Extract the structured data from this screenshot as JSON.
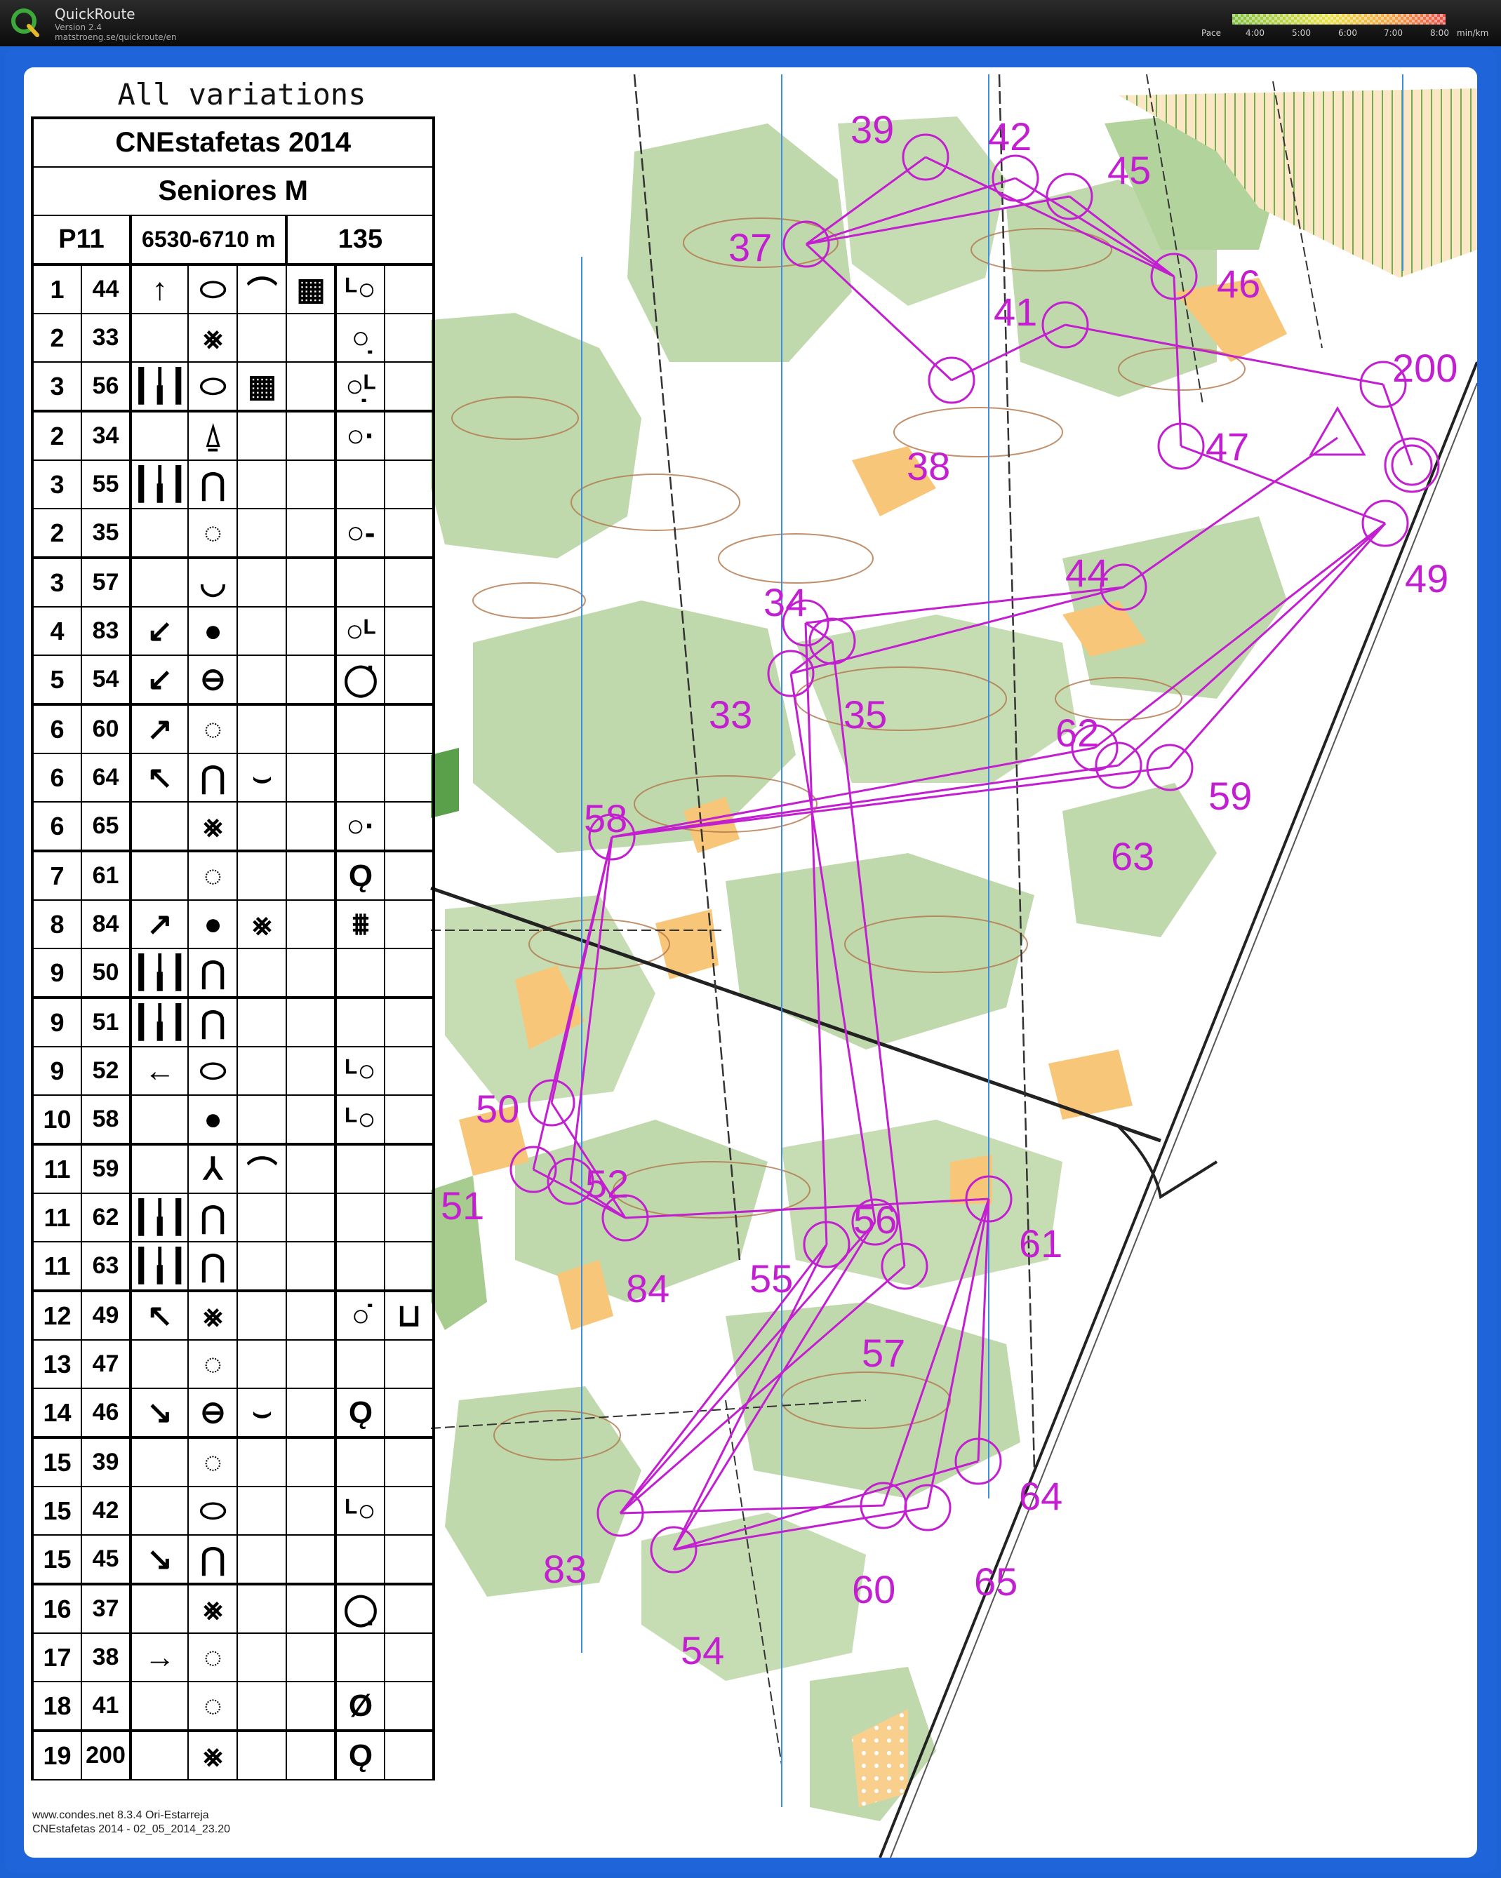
{
  "app": {
    "name": "QuickRoute",
    "version": "Version 2.4",
    "url": "matstroeng.se/quickroute/en",
    "pace_label": "Pace",
    "pace_ticks": [
      "4:00",
      "5:00",
      "6:00",
      "7:00",
      "8:00"
    ],
    "pace_unit": "min/km"
  },
  "header": {
    "variations": "All variations",
    "event": "CNEstafetas 2014",
    "category": "Seniores M",
    "course": "P11",
    "length": "6530-6710 m",
    "climb": "135"
  },
  "controls": [
    {
      "n": "1",
      "code": "44",
      "c": "↑",
      "d": "⬭",
      "e": "⌒",
      "f": "▦",
      "h": "ᴸ○"
    },
    {
      "n": "2",
      "code": "33",
      "c": "",
      "d": "⨳",
      "e": "",
      "f": "",
      "h": "○̣"
    },
    {
      "n": "3",
      "code": "56",
      "c": "┃╽┃",
      "d": "⬭",
      "e": "▦",
      "f": "",
      "h": "○̣ᴸ"
    },
    {
      "n": "2",
      "code": "34",
      "c": "",
      "d": "⍙",
      "e": "",
      "f": "",
      "h": "○·"
    },
    {
      "n": "3",
      "code": "55",
      "c": "┃╽┃",
      "d": "⋂",
      "e": "",
      "f": "",
      "h": ""
    },
    {
      "n": "2",
      "code": "35",
      "c": "",
      "d": "◌",
      "e": "",
      "f": "",
      "h": "○-"
    },
    {
      "n": "3",
      "code": "57",
      "c": "",
      "d": "◡",
      "e": "",
      "f": "",
      "h": ""
    },
    {
      "n": "4",
      "code": "83",
      "c": "↙",
      "d": "●",
      "e": "",
      "f": "",
      "h": "○ᴸ"
    },
    {
      "n": "5",
      "code": "54",
      "c": "↙",
      "d": "⊖",
      "e": "",
      "f": "",
      "h": "◯̇"
    },
    {
      "n": "6",
      "code": "60",
      "c": "↗",
      "d": "◌",
      "e": "",
      "f": "",
      "h": ""
    },
    {
      "n": "6",
      "code": "64",
      "c": "↖",
      "d": "⋂",
      "e": "⌣",
      "f": "",
      "h": ""
    },
    {
      "n": "6",
      "code": "65",
      "c": "",
      "d": "⨳",
      "e": "",
      "f": "",
      "h": "○·"
    },
    {
      "n": "7",
      "code": "61",
      "c": "",
      "d": "◌",
      "e": "",
      "f": "",
      "h": "Ǫ"
    },
    {
      "n": "8",
      "code": "84",
      "c": "↗",
      "d": "●",
      "e": "⨳",
      "f": "",
      "h": "⩩"
    },
    {
      "n": "9",
      "code": "50",
      "c": "┃╽┃",
      "d": "⋂",
      "e": "",
      "f": "",
      "h": ""
    },
    {
      "n": "9",
      "code": "51",
      "c": "┃╽┃",
      "d": "⋂",
      "e": "",
      "f": "",
      "h": ""
    },
    {
      "n": "9",
      "code": "52",
      "c": "←",
      "d": "⬭",
      "e": "",
      "f": "",
      "h": "ᴸ○"
    },
    {
      "n": "10",
      "code": "58",
      "c": "",
      "d": "●",
      "e": "",
      "f": "",
      "h": "ᴸ○"
    },
    {
      "n": "11",
      "code": "59",
      "c": "",
      "d": "⅄",
      "e": "⌒",
      "f": "",
      "h": ""
    },
    {
      "n": "11",
      "code": "62",
      "c": "┃╽┃",
      "d": "⋂",
      "e": "",
      "f": "",
      "h": ""
    },
    {
      "n": "11",
      "code": "63",
      "c": "┃╽┃",
      "d": "⋂",
      "e": "",
      "f": "",
      "h": ""
    },
    {
      "n": "12",
      "code": "49",
      "c": "↖",
      "d": "⨳",
      "e": "",
      "f": "",
      "h": "○̇",
      "i": "⊔"
    },
    {
      "n": "13",
      "code": "47",
      "c": "",
      "d": "◌",
      "e": "",
      "f": "",
      "h": ""
    },
    {
      "n": "14",
      "code": "46",
      "c": "↘",
      "d": "⊖",
      "e": "⌣",
      "f": "",
      "h": "Ǫ"
    },
    {
      "n": "15",
      "code": "39",
      "c": "",
      "d": "◌",
      "e": "",
      "f": "",
      "h": ""
    },
    {
      "n": "15",
      "code": "42",
      "c": "",
      "d": "⬭",
      "e": "",
      "f": "",
      "h": "ᴸ○"
    },
    {
      "n": "15",
      "code": "45",
      "c": "↘",
      "d": "⋂",
      "e": "",
      "f": "",
      "h": ""
    },
    {
      "n": "16",
      "code": "37",
      "c": "",
      "d": "⨳",
      "e": "",
      "f": "",
      "h": "◯̣"
    },
    {
      "n": "17",
      "code": "38",
      "c": "→",
      "d": "◌",
      "e": "",
      "f": "",
      "h": ""
    },
    {
      "n": "18",
      "code": "41",
      "c": "",
      "d": "◌",
      "e": "",
      "f": "",
      "h": "Ø"
    },
    {
      "n": "19",
      "code": "200",
      "c": "",
      "d": "⨳",
      "e": "",
      "f": "",
      "h": "Ǫ"
    }
  ],
  "footer": {
    "line1": "www.condes.net 8.3.4 Ori-Estarreja",
    "line2": "CNEstafetas 2014 - 02_05_2014_23.20"
  },
  "map_labels": [
    {
      "t": "39"
    },
    {
      "t": "42"
    },
    {
      "t": "45"
    },
    {
      "t": "37"
    },
    {
      "t": "41"
    },
    {
      "t": "46"
    },
    {
      "t": "200"
    },
    {
      "t": "38"
    },
    {
      "t": "47"
    },
    {
      "t": "49"
    },
    {
      "t": "44"
    },
    {
      "t": "34"
    },
    {
      "t": "33"
    },
    {
      "t": "35"
    },
    {
      "t": "62"
    },
    {
      "t": "59"
    },
    {
      "t": "63"
    },
    {
      "t": "58"
    },
    {
      "t": "50"
    },
    {
      "t": "51"
    },
    {
      "t": "52"
    },
    {
      "t": "56"
    },
    {
      "t": "61"
    },
    {
      "t": "55"
    },
    {
      "t": "84"
    },
    {
      "t": "57"
    },
    {
      "t": "64"
    },
    {
      "t": "83"
    },
    {
      "t": "60"
    },
    {
      "t": "65"
    },
    {
      "t": "54"
    }
  ],
  "colors": {
    "course": "#c21fd0",
    "forest": "#b8d6a6",
    "open": "#f8c679",
    "north_lines": "#3c8fe0",
    "frame": "#1f64d8"
  }
}
